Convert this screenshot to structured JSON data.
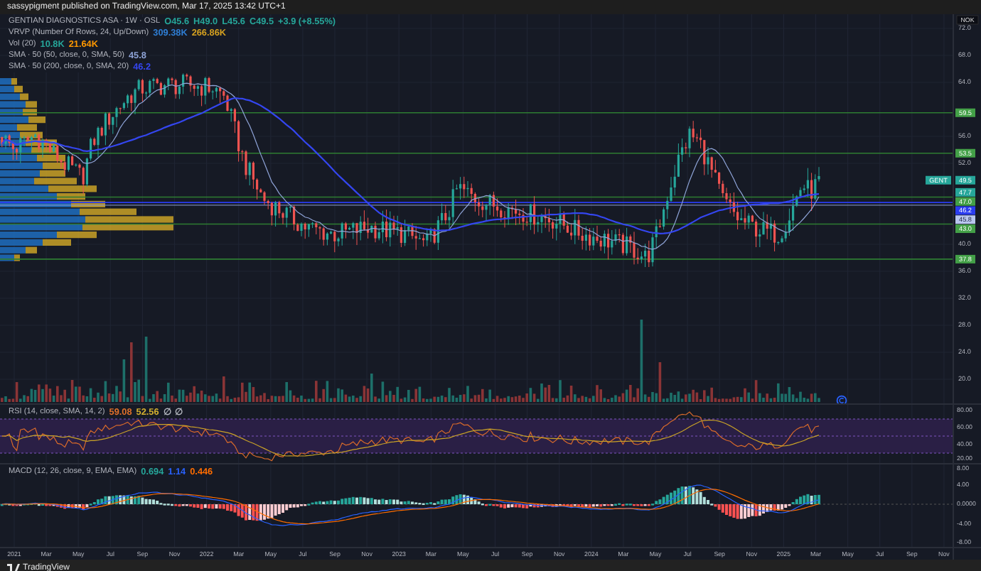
{
  "header": {
    "text": "sassypigment published on TradingView.com, Mar 17, 2025 13:42 UTC+1"
  },
  "legend": [
    {
      "label": "GENTIAN DIAGNOSTICS ASA · 1W · OSL",
      "values": [
        {
          "text": "O45.6",
          "color": "#26a69a"
        },
        {
          "text": "H49.0",
          "color": "#26a69a"
        },
        {
          "text": "L45.6",
          "color": "#26a69a"
        },
        {
          "text": "C49.5",
          "color": "#26a69a"
        },
        {
          "text": "+3.9 (+8.55%)",
          "color": "#26a69a"
        }
      ]
    },
    {
      "label": "VRVP (Number Of Rows, 24, Up/Down)",
      "values": [
        {
          "text": "309.38K",
          "color": "#2f7fd6"
        },
        {
          "text": "266.86K",
          "color": "#d4a020"
        }
      ]
    },
    {
      "label": "Vol (20)",
      "values": [
        {
          "text": "10.8K",
          "color": "#26a69a"
        },
        {
          "text": "21.64K",
          "color": "#ff9800"
        }
      ]
    },
    {
      "label": "SMA · 50 (50, close, 0, SMA, 50)",
      "values": [
        {
          "text": "45.8",
          "color": "#8fa4d8"
        }
      ]
    },
    {
      "label": "SMA · 50 (200, close, 0, SMA, 20)",
      "values": [
        {
          "text": "46.2",
          "color": "#3446f0"
        }
      ]
    }
  ],
  "price_axis": {
    "currency": "NOK",
    "ticks": [
      "72.0",
      "68.0",
      "64.0",
      "56.0",
      "52.0",
      "40.0",
      "36.0",
      "32.0",
      "28.0",
      "24.0",
      "20.0"
    ]
  },
  "symbol_tag": "GENT",
  "price_labels": [
    {
      "text": "59.5",
      "kind": "level"
    },
    {
      "text": "53.5",
      "kind": "level"
    },
    {
      "text": "49.5",
      "kind": "last"
    },
    {
      "text": "47.7",
      "kind": "last"
    },
    {
      "text": "47.0",
      "kind": "level"
    },
    {
      "text": "46.2",
      "kind": "sma"
    },
    {
      "text": "45.8",
      "kind": "sma_light"
    },
    {
      "text": "43.0",
      "kind": "level"
    },
    {
      "text": "37.8",
      "kind": "level"
    }
  ],
  "rsi": {
    "label": "RSI (14, close, SMA, 14, 2)",
    "values": [
      {
        "text": "59.08",
        "color": "#e0702a"
      },
      {
        "text": "52.56",
        "color": "#d4b030"
      },
      {
        "text": "∅",
        "color": "#b2b5be"
      },
      {
        "text": "∅",
        "color": "#b2b5be"
      }
    ],
    "ticks": [
      "80.00",
      "60.00",
      "40.00",
      "20.00"
    ]
  },
  "macd": {
    "label": "MACD (12, 26, close, 9, EMA, EMA)",
    "values": [
      {
        "text": "0.694",
        "color": "#26a69a"
      },
      {
        "text": "1.14",
        "color": "#2962ff"
      },
      {
        "text": "0.446",
        "color": "#ff6d00"
      }
    ],
    "ticks": [
      "8.00",
      "4.00",
      "0.0000",
      "-4.00",
      "-8.00"
    ]
  },
  "time_axis": [
    "2021",
    "Mar",
    "May",
    "Jul",
    "Sep",
    "Nov",
    "2022",
    "Mar",
    "May",
    "Jul",
    "Sep",
    "Nov",
    "2023",
    "Mar",
    "May",
    "Jul",
    "Sep",
    "Nov",
    "2024",
    "Mar",
    "May",
    "Jul",
    "Sep",
    "Nov",
    "2025",
    "Mar",
    "May",
    "Jul",
    "Sep",
    "Nov"
  ],
  "footer": {
    "brand": "TradingView"
  }
}
